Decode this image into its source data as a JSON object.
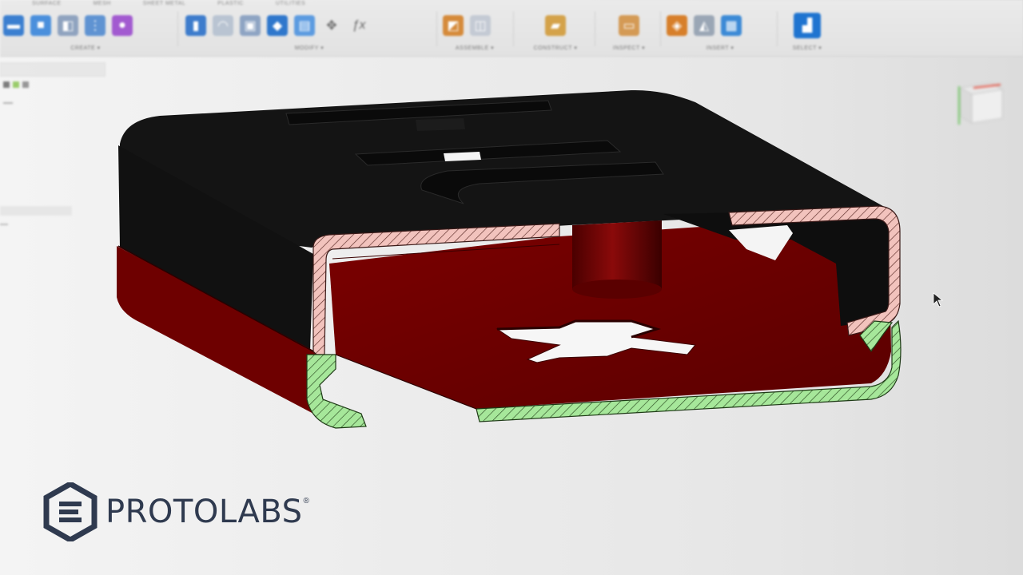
{
  "toolbar": {
    "tabs": [
      "SURFACE",
      "MESH",
      "SHEET METAL",
      "PLASTIC",
      "UTILITIES"
    ],
    "groups": [
      {
        "label": "CREATE ▾"
      },
      {
        "label": "MODIFY ▾"
      },
      {
        "label": "ASSEMBLE ▾"
      },
      {
        "label": "CONSTRUCT ▾"
      },
      {
        "label": "INSPECT ▾"
      },
      {
        "label": "INSERT ▾"
      },
      {
        "label": "SELECT ▾"
      }
    ],
    "icons": {
      "create": [
        "new-component-icon",
        "extrude-icon",
        "revolve-icon",
        "sweep-icon",
        "form-icon"
      ],
      "modify": [
        "press-pull-icon",
        "fillet-icon",
        "shell-icon",
        "combine-icon",
        "split-icon",
        "move-icon",
        "parameters-icon"
      ],
      "assemble": [
        "joint-icon",
        "as-built-joint-icon"
      ],
      "construct": [
        "plane-icon"
      ],
      "inspect": [
        "measure-icon"
      ],
      "insert": [
        "insert-mcmaster-icon",
        "insert-svg-icon",
        "canvas-icon"
      ],
      "select": [
        "select-icon"
      ]
    }
  },
  "left_panel": {
    "rows": [
      "",
      "",
      "",
      "",
      "",
      "",
      "",
      "",
      "",
      "",
      "",
      ""
    ]
  },
  "colors": {
    "body_dark": "#151515",
    "body_red": "#6e0000",
    "section_pink": "#f2c3bd",
    "section_green": "#a6e79a",
    "logo": "#2f3a4f"
  },
  "logo": {
    "text": "PROTOLABS",
    "reg": "®"
  }
}
